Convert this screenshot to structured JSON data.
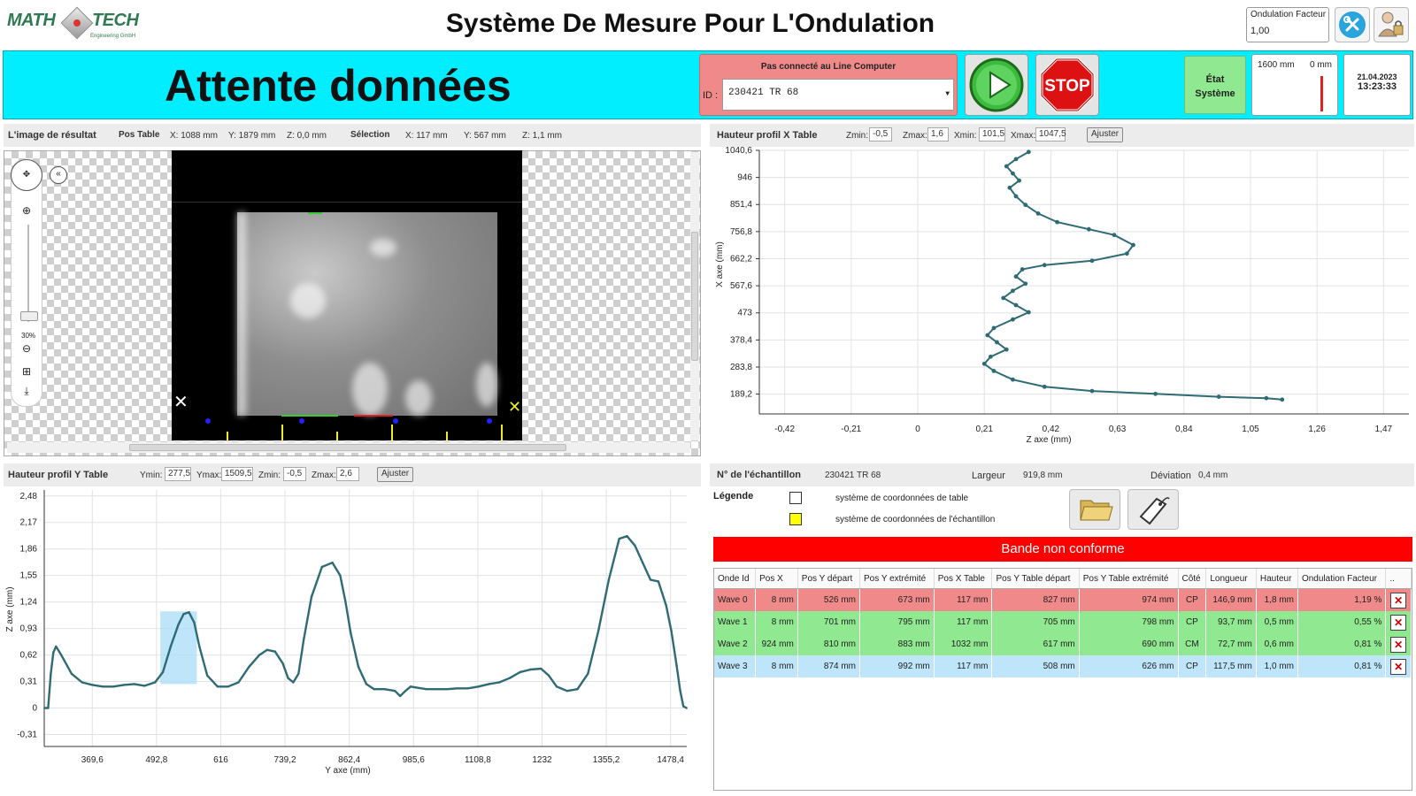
{
  "header": {
    "logo_left": "MATH",
    "logo_right": "TECH",
    "logo_sub": "Engineering GmbH",
    "title": "Système De Mesure Pour L'Ondulation",
    "factor_label": "Ondulation Facteur",
    "factor_value": "1,00",
    "tools_icon": "tools-icon",
    "user_icon": "user-lock-icon"
  },
  "banner": {
    "status": "Attente données",
    "connection": "Pas connecté au Line Computer",
    "id_label": "ID :",
    "id_value": "230421  TR  68",
    "play_icon": "play-icon",
    "stop_label": "STOP",
    "etat_line1": "État",
    "etat_line2": "Système",
    "dim_length": "1600 mm",
    "dim_zero": "0 mm",
    "date": "21.04.2023",
    "time": "13:23:33",
    "colors": {
      "banner": "#00eeff",
      "warning": "#f08a8a",
      "ok": "#90e890"
    }
  },
  "image_panel": {
    "title": "L'image de résultat",
    "pos_label": "Pos Table",
    "pos_x": "X: 1088 mm",
    "pos_y": "Y: 1879 mm",
    "pos_z": "Z:   0,0 mm",
    "sel_label": "Sélection",
    "sel_x": "X:   117 mm",
    "sel_y": "Y:   567 mm",
    "sel_z": "Z:   1,1 mm",
    "zoom": "30%"
  },
  "x_profile": {
    "title": "Hauteur profil  X Table",
    "zmin_label": "Zmin:",
    "zmin": "-0,5",
    "zmax_label": "Zmax:",
    "zmax": "1,6",
    "xmin_label": "Xmin:",
    "xmin": "101,5",
    "xmax_label": "Xmax:",
    "xmax": "1047,5",
    "adjust": "Ajuster"
  },
  "y_profile": {
    "title": "Hauteur profil  Y Table",
    "ymin_label": "Ymin:",
    "ymin": "277,5",
    "ymax_label": "Ymax:",
    "ymax": "1509,5",
    "zmin_label": "Zmin:",
    "zmin": "-0,5",
    "zmax_label": "Zmax:",
    "zmax": "2,6",
    "adjust": "Ajuster"
  },
  "sample": {
    "label": "N° de l'échantillon",
    "id": "230421 TR 68",
    "width_label": "Largeur",
    "width": "919,8 mm",
    "dev_label": "Déviation",
    "dev": "0,4 mm",
    "legend": "Légende",
    "legend1": "système de coordonnées de table",
    "legend2": "système de coordonnées de l'échantillon",
    "folder_icon": "folder-icon",
    "tag_icon": "tag-icon",
    "nonconform": "Bande non conforme"
  },
  "table": {
    "headers": [
      "Onde Id",
      "Pos X",
      "Pos Y départ",
      "Pos Y extrémité",
      "Pos X Table",
      "Pos Y Table départ",
      "Pos Y Table extrémité",
      "Côté",
      "Longueur",
      "Hauteur",
      "Ondulation Facteur",
      ".."
    ],
    "rows": [
      [
        "Wave 0",
        "8 mm",
        "526 mm",
        "673 mm",
        "117 mm",
        "827 mm",
        "974 mm",
        "CP",
        "146,9 mm",
        "1,8 mm",
        "1,19 %"
      ],
      [
        "Wave 1",
        "8 mm",
        "701 mm",
        "795 mm",
        "117 mm",
        "705 mm",
        "798 mm",
        "CP",
        "93,7 mm",
        "0,5 mm",
        "0,55 %"
      ],
      [
        "Wave 2",
        "924 mm",
        "810 mm",
        "883 mm",
        "1032 mm",
        "617 mm",
        "690 mm",
        "CM",
        "72,7 mm",
        "0,6 mm",
        "0,81 %"
      ],
      [
        "Wave 3",
        "8 mm",
        "874 mm",
        "992 mm",
        "117 mm",
        "508 mm",
        "626 mm",
        "CP",
        "117,5 mm",
        "1,0 mm",
        "0,81 %"
      ]
    ],
    "delete_symbol": "✕"
  },
  "chart_data": [
    {
      "type": "scatter",
      "title": "Hauteur profil  X Table",
      "xlabel": "Z axe (mm)",
      "ylabel": "X axe (mm)",
      "xlim": [
        -0.5,
        1.55
      ],
      "ylim": [
        120,
        1040.6
      ],
      "x_ticks": [
        "-0,42",
        "-0,21",
        "0",
        "0,21",
        "0,42",
        "0,63",
        "0,84",
        "1,05",
        "1,26",
        "1,47"
      ],
      "y_ticks": [
        "1040,6",
        "946",
        "851,4",
        "756,8",
        "662,2",
        "567,6",
        "473",
        "378,4",
        "283,8",
        "189,2"
      ],
      "grid": true,
      "series": [
        {
          "x": [
            0.35,
            0.31,
            0.28,
            0.3,
            0.32,
            0.29,
            0.31,
            0.34,
            0.38,
            0.44,
            0.54,
            0.62,
            0.68,
            0.66,
            0.55,
            0.4,
            0.33,
            0.31,
            0.34,
            0.3,
            0.27,
            0.31,
            0.35,
            0.3,
            0.24,
            0.22,
            0.25,
            0.28,
            0.23,
            0.21,
            0.24,
            0.3,
            0.4,
            0.55,
            0.75,
            0.95,
            1.1,
            1.15
          ],
          "y": [
            1035,
            1010,
            985,
            960,
            935,
            910,
            880,
            850,
            820,
            790,
            765,
            745,
            710,
            680,
            655,
            640,
            625,
            600,
            575,
            550,
            525,
            500,
            475,
            450,
            420,
            395,
            370,
            345,
            320,
            295,
            270,
            240,
            215,
            200,
            190,
            180,
            175,
            170
          ]
        }
      ]
    },
    {
      "type": "line",
      "title": "Hauteur profil  Y Table",
      "xlabel": "Y axe (mm)",
      "ylabel": "Z axe (mm)",
      "xlim": [
        277.5,
        1509.5
      ],
      "ylim": [
        -0.45,
        2.55
      ],
      "x_ticks": [
        "369,6",
        "492,8",
        "616",
        "739,2",
        "862,4",
        "985,6",
        "1108,8",
        "1232",
        "1355,2",
        "1478,4"
      ],
      "y_ticks": [
        "2,48",
        "2,17",
        "1,86",
        "1,55",
        "1,24",
        "0,93",
        "0,62",
        "0,31",
        "0",
        "-0,31"
      ],
      "grid": true,
      "highlight": {
        "x_from": 500,
        "x_to": 570,
        "z_from": 0.28,
        "z_to": 1.13
      },
      "series": [
        {
          "x": [
            278,
            285,
            290,
            295,
            300,
            310,
            330,
            350,
            370,
            390,
            410,
            430,
            450,
            470,
            490,
            505,
            520,
            535,
            545,
            555,
            565,
            575,
            590,
            610,
            630,
            650,
            670,
            690,
            705,
            720,
            735,
            745,
            755,
            765,
            775,
            790,
            810,
            830,
            845,
            855,
            865,
            880,
            895,
            910,
            930,
            950,
            960,
            970,
            980,
            990,
            1010,
            1030,
            1050,
            1070,
            1090,
            1110,
            1130,
            1150,
            1170,
            1190,
            1210,
            1230,
            1245,
            1260,
            1280,
            1300,
            1320,
            1340,
            1360,
            1380,
            1395,
            1410,
            1425,
            1440,
            1455,
            1470,
            1480,
            1490,
            1497,
            1503,
            1509
          ],
          "y": [
            0.0,
            0.0,
            0.4,
            0.65,
            0.72,
            0.62,
            0.4,
            0.3,
            0.27,
            0.25,
            0.25,
            0.27,
            0.28,
            0.26,
            0.3,
            0.42,
            0.72,
            0.98,
            1.1,
            1.12,
            1.0,
            0.72,
            0.38,
            0.25,
            0.25,
            0.3,
            0.48,
            0.62,
            0.68,
            0.66,
            0.52,
            0.35,
            0.3,
            0.4,
            0.8,
            1.3,
            1.65,
            1.7,
            1.55,
            1.25,
            0.88,
            0.48,
            0.28,
            0.22,
            0.22,
            0.2,
            0.14,
            0.2,
            0.25,
            0.24,
            0.22,
            0.22,
            0.22,
            0.23,
            0.23,
            0.25,
            0.28,
            0.3,
            0.35,
            0.42,
            0.45,
            0.46,
            0.38,
            0.25,
            0.2,
            0.22,
            0.4,
            0.9,
            1.5,
            1.98,
            2.01,
            1.9,
            1.7,
            1.5,
            1.48,
            1.2,
            0.9,
            0.5,
            0.2,
            0.02,
            0.0
          ]
        }
      ]
    }
  ]
}
